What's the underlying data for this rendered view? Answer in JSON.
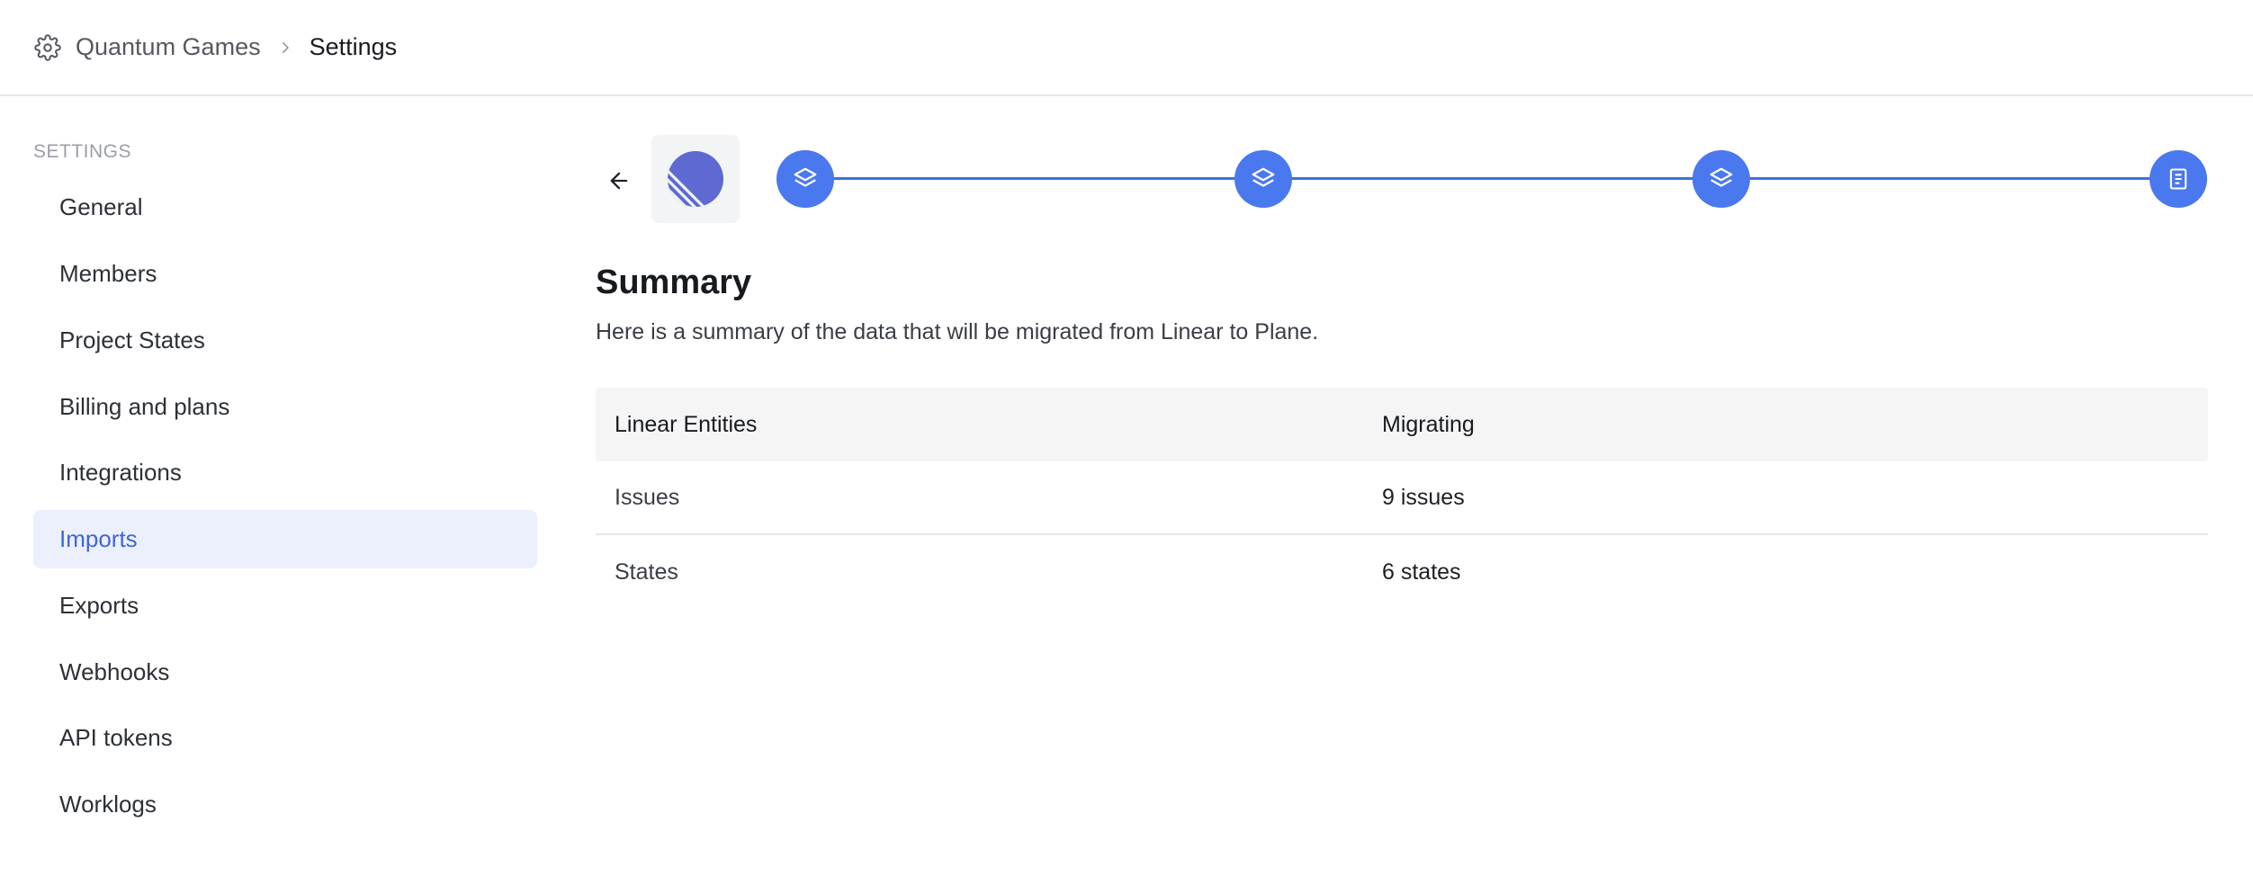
{
  "breadcrumb": {
    "workspace": "Quantum Games",
    "current": "Settings"
  },
  "sidebar": {
    "heading": "SETTINGS",
    "items": [
      {
        "label": "General"
      },
      {
        "label": "Members"
      },
      {
        "label": "Project States"
      },
      {
        "label": "Billing and plans"
      },
      {
        "label": "Integrations"
      },
      {
        "label": "Imports",
        "active": true
      },
      {
        "label": "Exports"
      },
      {
        "label": "Webhooks"
      },
      {
        "label": "API tokens"
      },
      {
        "label": "Worklogs"
      }
    ]
  },
  "importer": {
    "source_logo": "linear-logo",
    "steps": [
      {
        "icon": "layers-icon",
        "status": "complete"
      },
      {
        "icon": "layers-icon",
        "status": "complete"
      },
      {
        "icon": "layers-icon",
        "status": "complete"
      },
      {
        "icon": "document-icon",
        "status": "current"
      }
    ]
  },
  "summary": {
    "title": "Summary",
    "description": "Here is a summary of the data that will be migrated from Linear to Plane.",
    "table": {
      "headers": [
        "Linear Entities",
        "Migrating"
      ],
      "rows": [
        [
          "Issues",
          "9 issues"
        ],
        [
          "States",
          "6 states"
        ]
      ]
    }
  },
  "colors": {
    "accent": "#4a78ee",
    "active_bg": "#ecf0fd",
    "active_text": "#3f67d4"
  }
}
